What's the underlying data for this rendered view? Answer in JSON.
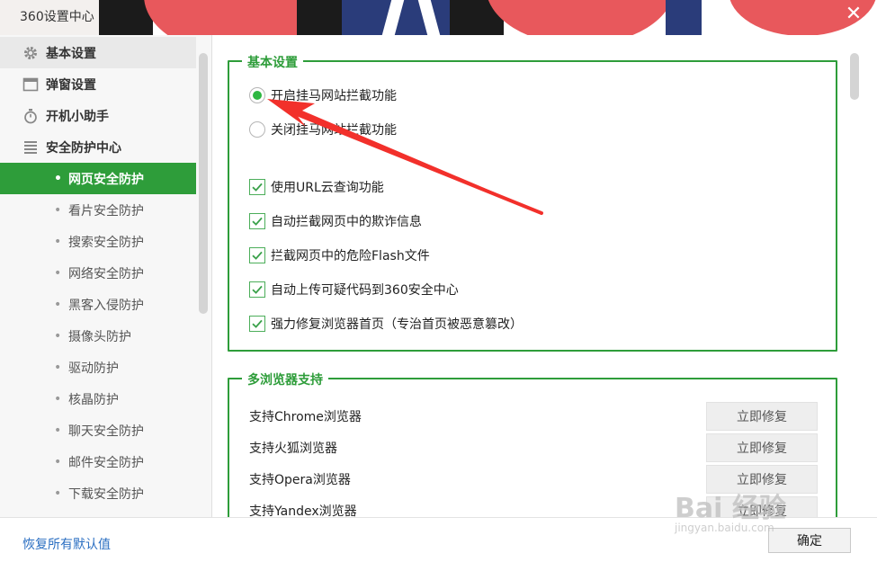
{
  "window": {
    "title": "360设置中心",
    "close_glyph": "✕"
  },
  "sidebar": {
    "top_items": [
      {
        "label": "基本设置",
        "icon": "gear-icon"
      },
      {
        "label": "弹窗设置",
        "icon": "window-icon"
      },
      {
        "label": "开机小助手",
        "icon": "stopwatch-icon"
      },
      {
        "label": "安全防护中心",
        "icon": "shield-list-icon"
      }
    ],
    "sub_items": [
      {
        "label": "网页安全防护",
        "active": true
      },
      {
        "label": "看片安全防护"
      },
      {
        "label": "搜索安全防护"
      },
      {
        "label": "网络安全防护"
      },
      {
        "label": "黑客入侵防护"
      },
      {
        "label": "摄像头防护"
      },
      {
        "label": "驱动防护"
      },
      {
        "label": "核晶防护"
      },
      {
        "label": "聊天安全防护"
      },
      {
        "label": "邮件安全防护"
      },
      {
        "label": "下载安全防护"
      }
    ]
  },
  "basic_group": {
    "title": "基本设置",
    "radios": [
      {
        "label": "开启挂马网站拦截功能",
        "selected": true
      },
      {
        "label": "关闭挂马网站拦截功能",
        "selected": false
      }
    ],
    "checkboxes": [
      {
        "label": "使用URL云查询功能",
        "checked": true
      },
      {
        "label": "自动拦截网页中的欺诈信息",
        "checked": true
      },
      {
        "label": "拦截网页中的危险Flash文件",
        "checked": true
      },
      {
        "label": "自动上传可疑代码到360安全中心",
        "checked": true
      },
      {
        "label": "强力修复浏览器首页（专治首页被恶意篡改）",
        "checked": true
      }
    ]
  },
  "browser_group": {
    "title": "多浏览器支持",
    "rows": [
      {
        "label": "支持Chrome浏览器",
        "button": "立即修复"
      },
      {
        "label": "支持火狐浏览器",
        "button": "立即修复"
      },
      {
        "label": "支持Opera浏览器",
        "button": "立即修复"
      },
      {
        "label": "支持Yandex浏览器",
        "button": "立即修复"
      }
    ]
  },
  "footer": {
    "restore_label": "恢复所有默认值",
    "ok_label": "确定"
  },
  "watermark": {
    "main": "Bai 经验",
    "sub": "jingyan.baidu.com"
  },
  "colors": {
    "accent": "#2e9d3a",
    "arrow": "#f2302b",
    "link": "#2b6fc2"
  }
}
